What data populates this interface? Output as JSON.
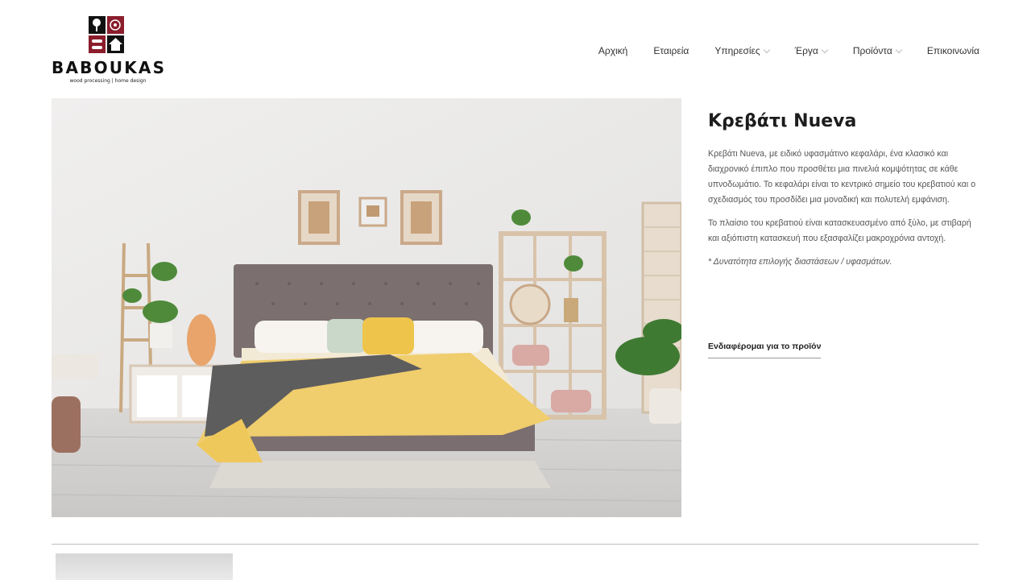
{
  "brand": {
    "name": "BABOUKAS",
    "tagline": "wood processing | home design"
  },
  "nav": {
    "items": [
      {
        "label": "Αρχική"
      },
      {
        "label": "Εταιρεία"
      },
      {
        "label": "Υπηρεσίες"
      },
      {
        "label": "Έργα"
      },
      {
        "label": "Προϊόντα"
      },
      {
        "label": "Επικοινωνία"
      }
    ]
  },
  "product": {
    "title": "Κρεβάτι Nueva",
    "paragraph1": "Κρεβάτι Nueva, με ειδικό υφασμάτινο κεφαλάρι, ένα κλασικό και διαχρονικό έπιπλο που προσθέτει μια πινελιά κομψότητας σε κάθε υπνοδωμάτιο. Το κεφαλάρι είναι το κεντρικό σημείο του κρεβατιού και ο σχεδιασμός του προσδίδει μια μοναδική και πολυτελή εμφάνιση.",
    "paragraph2": "Το πλαίσιο του κρεβατιού είναι  κατασκευασμένο από ξύλο, με στιβαρή και αξιόπιστη κατασκευή που εξασφαλίζει μακροχρόνια αντοχή.",
    "note": "* Δυνατότητα επιλογής διαστάσεων / υφασμάτων.",
    "cta": "Ενδιαφέρομαι για το προϊόν"
  },
  "colors": {
    "logo_red": "#8b1d2c",
    "logo_black": "#111111",
    "text": "#333333"
  }
}
